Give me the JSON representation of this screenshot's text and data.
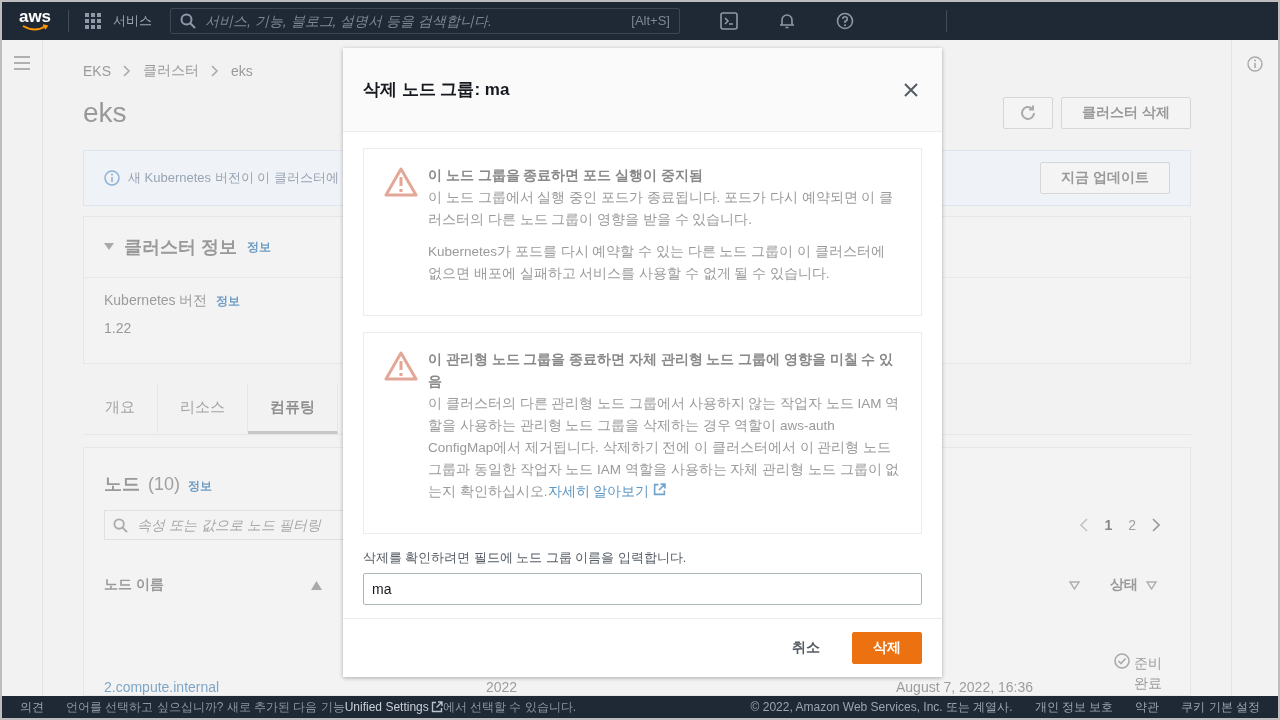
{
  "top_bar": {
    "logo": "aws",
    "services": "서비스",
    "search": {
      "placeholder": "서비스, 기능, 블로그, 설명서 등을 검색합니다.",
      "shortcut": "[Alt+S]"
    }
  },
  "breadcrumbs": [
    "EKS",
    "클러스터",
    "eks"
  ],
  "page_title": "eks",
  "header_buttons": {
    "delete": "클러스터 삭제"
  },
  "banner": {
    "text": "새 Kubernetes 버전이 이 클러스터에",
    "button": "지금 업데이트"
  },
  "cluster_info": {
    "title": "클러스터 정보",
    "info_link": "정보",
    "expanded": true,
    "fields": [
      {
        "label": "Kubernetes 버전",
        "info_link": "정보",
        "value": "1.22"
      }
    ]
  },
  "tabs": [
    {
      "label": "개요",
      "selected": false
    },
    {
      "label": "리소스",
      "selected": false
    },
    {
      "label": "컴퓨팅",
      "selected": true
    }
  ],
  "nodes": {
    "title": "노드",
    "count": "(10)",
    "info_link": "정보",
    "filter": {
      "placeholder": "속성 또는 값으로 노드 필터링"
    },
    "pages": [
      {
        "label": "1",
        "selected": true
      },
      {
        "label": "2",
        "selected": false
      }
    ],
    "columns": [
      {
        "label": "노드 이름",
        "sorted": true
      },
      {
        "sorted": false
      },
      {
        "label": "상태",
        "sorted": false
      }
    ],
    "row": {
      "name": "2.compute.internal",
      "created_year": "2022",
      "created": "August 7, 2022, 16:36",
      "status": "준비 완료"
    }
  },
  "dialog": {
    "title": "삭제 노드 그룹: ma",
    "alerts": [
      {
        "title": "이 노드 그룹을 종료하면 포드 실행이 중지됨",
        "paragraphs": [
          "이 노드 그룹에서 실행 중인 포드가 종료됩니다. 포드가 다시 예약되면 이 클러스터의 다른 노드 그룹이 영향을 받을 수 있습니다.",
          "Kubernetes가 포드를 다시 예약할 수 있는 다른 노드 그룹이 이 클러스터에 없으면 배포에 실패하고 서비스를 사용할 수 없게 될 수 있습니다."
        ]
      },
      {
        "title": "이 관리형 노드 그룹을 종료하면 자체 관리형 노드 그룹에 영향을 미칠 수 있음",
        "paragraphs": [
          "이 클러스터의 다른 관리형 노드 그룹에서 사용하지 않는 작업자 노드 IAM 역할을 사용하는 관리형 노드 그룹을 삭제하는 경우 역할이 aws-auth ConfigMap에서 제거됩니다. 삭제하기 전에 이 클러스터에서 이 관리형 노드 그룹과 동일한 작업자 노드 IAM 역할을 사용하는 자체 관리형 노드 그룹이 없는지 확인하십시오."
        ],
        "link": "자세히 알아보기"
      }
    ],
    "confirm": {
      "label": "삭제를 확인하려면 필드에 노드 그룹 이름을 입력합니다.",
      "value": "ma"
    },
    "buttons": [
      {
        "label": "취소",
        "kind": "secondary"
      },
      {
        "label": "삭제",
        "kind": "primary"
      }
    ]
  },
  "footer": {
    "feedback": "의견",
    "notice": {
      "before": "언어를 선택하고 싶으십니까? 새로 추가된 다음 기능",
      "link": "Unified Settings",
      "after": "에서 선택할 수 있습니다."
    },
    "copyright": "© 2022, Amazon Web Services, Inc. 또는 계열사.",
    "links": [
      "개인 정보 보호",
      "약관",
      "쿠키 기본 설정"
    ]
  }
}
